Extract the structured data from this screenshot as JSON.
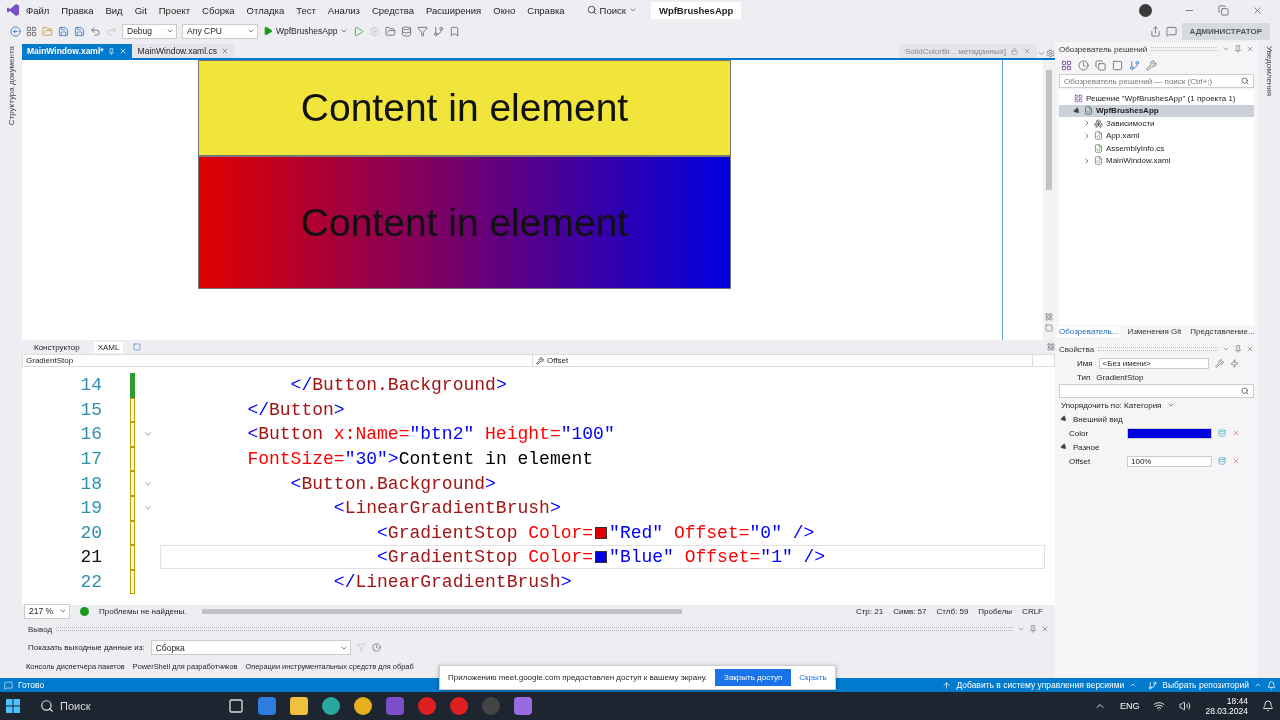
{
  "menu": {
    "items": [
      "Файл",
      "Правка",
      "Вид",
      "Git",
      "Проект",
      "Сборка",
      "Отладка",
      "Тест",
      "Анализ",
      "Средства",
      "Расширения",
      "Окно",
      "Справка"
    ],
    "search": "Поиск",
    "solution_title": "WpfBrushesApp"
  },
  "toolbar": {
    "configuration": "Debug",
    "platform": "Any CPU",
    "run_target": "WpfBrushesApp",
    "account_badge": "АДМИНИСТРАТОР"
  },
  "left_strip": {
    "label": "Структура документа"
  },
  "document_tabs": [
    {
      "label": "MainWindow.xaml*",
      "selected": true
    },
    {
      "label": "MainWindow.xaml.cs",
      "selected": false
    }
  ],
  "preview_tab": {
    "label": "SolidColorBr... метаданных]"
  },
  "designer": {
    "elements": [
      {
        "label": "Content in element",
        "kind": "solid",
        "color": "#f1e43a"
      },
      {
        "label": "Content in element",
        "kind": "gradient"
      }
    ]
  },
  "editor_tabs": [
    {
      "label": "Конструктор",
      "selected": false
    },
    {
      "label": "XAML",
      "selected": true
    }
  ],
  "breadcrumbs": {
    "element": "GradientStop",
    "member": "Offset"
  },
  "code_lines": [
    {
      "number": "14",
      "saved": true,
      "foldable": false,
      "current": false,
      "tokens": [
        {
          "kind": "punct",
          "text": "            </"
        },
        {
          "kind": "element",
          "text": "Button.Background"
        },
        {
          "kind": "punct",
          "text": ">"
        }
      ]
    },
    {
      "number": "15",
      "saved": false,
      "foldable": false,
      "current": false,
      "tokens": [
        {
          "kind": "punct",
          "text": "        </"
        },
        {
          "kind": "element",
          "text": "Button"
        },
        {
          "kind": "punct",
          "text": ">"
        }
      ]
    },
    {
      "number": "16",
      "saved": false,
      "foldable": true,
      "current": false,
      "tokens": [
        {
          "kind": "punct",
          "text": "        <"
        },
        {
          "kind": "element",
          "text": "Button"
        },
        {
          "kind": "attr",
          "text": " x:Name="
        },
        {
          "kind": "value",
          "text": "\"btn2\""
        },
        {
          "kind": "attr",
          "text": " Height="
        },
        {
          "kind": "value",
          "text": "\"100\""
        }
      ]
    },
    {
      "number": "17",
      "saved": false,
      "foldable": false,
      "current": false,
      "tokens": [
        {
          "kind": "attr",
          "text": "        FontSize="
        },
        {
          "kind": "value",
          "text": "\"30\""
        },
        {
          "kind": "punct",
          "text": ">"
        },
        {
          "kind": "text",
          "text": "Content in element"
        }
      ]
    },
    {
      "number": "18",
      "saved": false,
      "foldable": true,
      "current": false,
      "tokens": [
        {
          "kind": "punct",
          "text": "            <"
        },
        {
          "kind": "element",
          "text": "Button.Background"
        },
        {
          "kind": "punct",
          "text": ">"
        }
      ]
    },
    {
      "number": "19",
      "saved": false,
      "foldable": true,
      "current": false,
      "tokens": [
        {
          "kind": "punct",
          "text": "                <"
        },
        {
          "kind": "element",
          "text": "LinearGradientBrush"
        },
        {
          "kind": "punct",
          "text": ">"
        }
      ]
    },
    {
      "number": "20",
      "saved": false,
      "foldable": false,
      "current": false,
      "tokens": [
        {
          "kind": "punct",
          "text": "                    <"
        },
        {
          "kind": "element",
          "text": "GradientStop"
        },
        {
          "kind": "attr",
          "text": " Color="
        },
        {
          "kind": "swatch",
          "color": "#e00000"
        },
        {
          "kind": "value",
          "text": "\"Red\""
        },
        {
          "kind": "attr",
          "text": " Offset="
        },
        {
          "kind": "value",
          "text": "\"0\""
        },
        {
          "kind": "punct",
          "text": " />"
        }
      ]
    },
    {
      "number": "21",
      "saved": false,
      "foldable": false,
      "current": true,
      "tokens": [
        {
          "kind": "punct",
          "text": "                    <"
        },
        {
          "kind": "element",
          "text": "GradientStop"
        },
        {
          "kind": "attr",
          "text": " Color="
        },
        {
          "kind": "swatch",
          "color": "#0000e0"
        },
        {
          "kind": "value",
          "text": "\"Blue\""
        },
        {
          "kind": "attr",
          "text": " Offset="
        },
        {
          "kind": "value",
          "text": "\"1\""
        },
        {
          "kind": "punct",
          "text": " />"
        }
      ]
    },
    {
      "number": "22",
      "saved": false,
      "foldable": false,
      "current": false,
      "tokens": [
        {
          "kind": "punct",
          "text": "                </"
        },
        {
          "kind": "element",
          "text": "LinearGradientBrush"
        },
        {
          "kind": "punct",
          "text": ">"
        }
      ]
    }
  ],
  "editor_status": {
    "zoom": "217 %",
    "problems": "Проблемы не найдены.",
    "line": "Стр: 21",
    "char": "Симв: 57",
    "column": "Стлб: 59",
    "whitespace": "Пробелы",
    "line_ending": "CRLF"
  },
  "output": {
    "title": "Вывод",
    "source_label": "Показать выходные данные из:",
    "source": "Сборка"
  },
  "bottom_tabs": [
    "Консоль диспетчера пакетов",
    "PowerShell для разработчиков",
    "Операции инструментальных средств для обраб"
  ],
  "notification": {
    "message": "Приложению meet.google.com предоставлен доступ к вашему экрану.",
    "primary": "Закрыть доступ",
    "secondary": "Скрыть"
  },
  "solution_explorer": {
    "title": "Обозреватель решений",
    "search_placeholder": "Обозреватель решений — поиск (Ctrl+;)",
    "tree": [
      {
        "label": "Решение \"WpfBrushesApp\"  (1 проекта 1)",
        "kind": "solution",
        "selected": false,
        "children": [
          {
            "label": "WpfBrushesApp",
            "kind": "project",
            "expanded": true,
            "selected": true,
            "has_children": true,
            "children": [
              {
                "label": "Зависимости",
                "kind": "dependencies",
                "expanded": false,
                "selected": false,
                "has_children": true
              },
              {
                "label": "App.xaml",
                "kind": "xaml",
                "expanded": false,
                "selected": false,
                "has_children": true
              },
              {
                "label": "AssemblyInfo.cs",
                "kind": "csharp",
                "expanded": false,
                "selected": false,
                "has_children": false
              },
              {
                "label": "MainWindow.xaml",
                "kind": "xaml",
                "expanded": false,
                "selected": false,
                "has_children": true
              }
            ]
          }
        ]
      }
    ],
    "tabs": [
      {
        "label": "Обозреватель...",
        "selected": true
      },
      {
        "label": "Изменения Git",
        "selected": false
      },
      {
        "label": "Представление...",
        "selected": false
      }
    ]
  },
  "properties": {
    "title": "Свойства",
    "name_label": "Имя",
    "name_value": "<Без имени>",
    "type_label": "Тип",
    "type_value": "GradientStop",
    "sort": "Упорядочить по: Категория",
    "categories": [
      {
        "label": "Внешний вид",
        "expanded": true,
        "rows": [
          {
            "label": "Color",
            "kind": "color",
            "color": "#0000e0"
          }
        ]
      },
      {
        "label": "Разное",
        "expanded": true,
        "rows": [
          {
            "label": "Offset",
            "kind": "text",
            "value": "100%"
          }
        ]
      }
    ]
  },
  "notifications_strip": {
    "label": "Уведомления"
  },
  "status_bar": {
    "state": "Готово",
    "add_to_source_control": "Добавить в систему управления версиями",
    "select_repository": "Выбрать репозиторий"
  },
  "taskbar": {
    "search": "Поиск",
    "language": "ENG",
    "time": "18:44",
    "date": "28.03.2024"
  }
}
